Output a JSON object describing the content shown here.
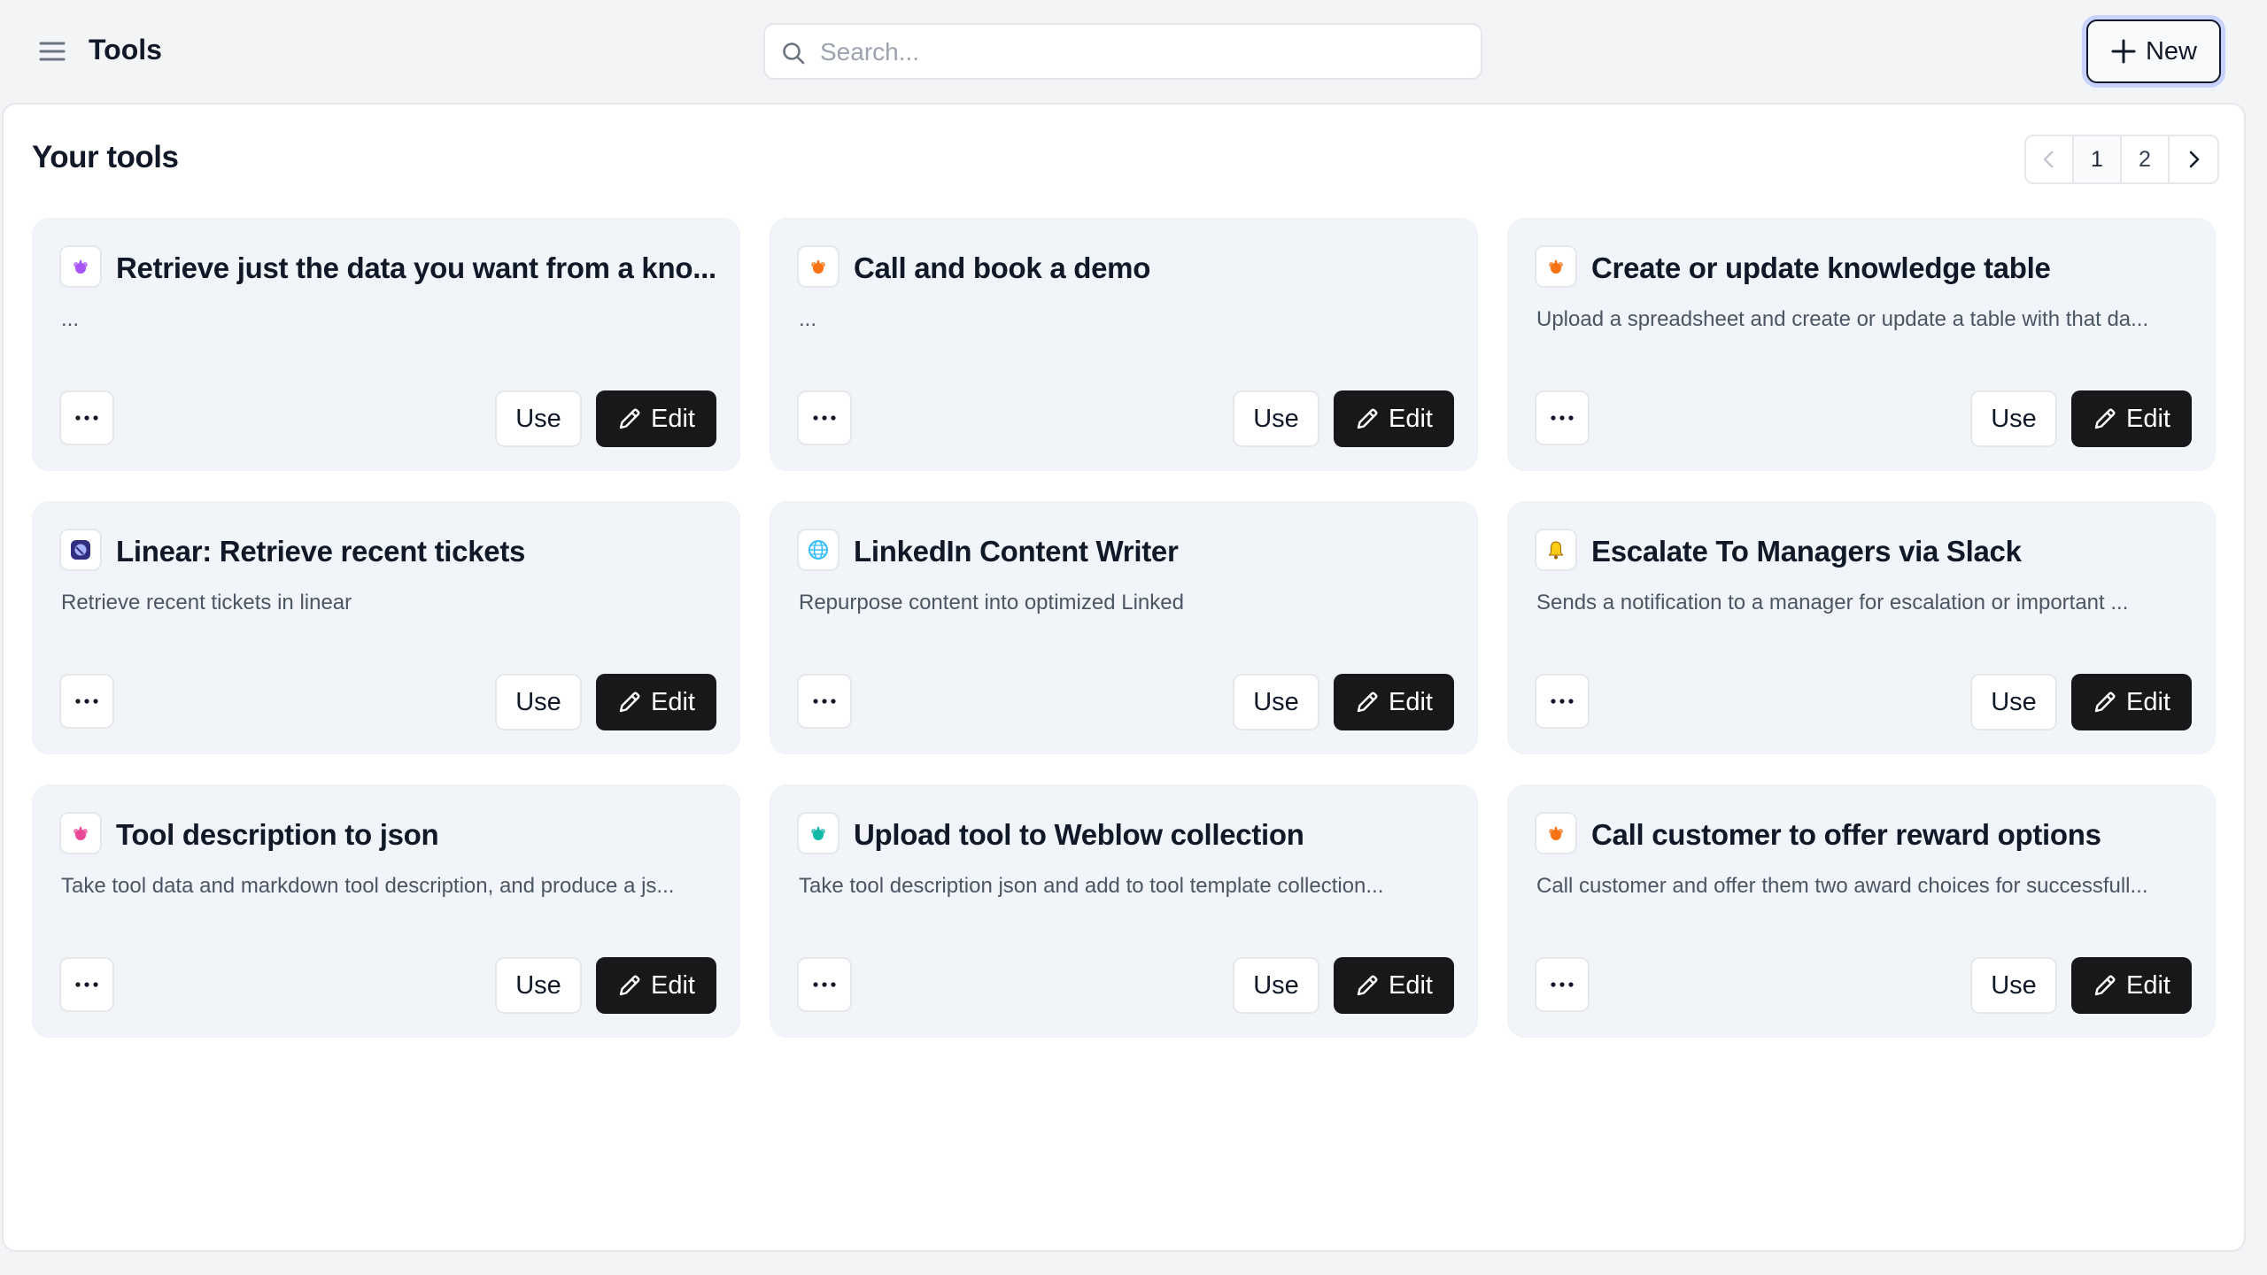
{
  "header": {
    "title": "Tools",
    "menu_icon": "hamburger-icon",
    "search": {
      "placeholder": "Search...",
      "value": ""
    },
    "new_label": "New"
  },
  "main": {
    "section_title": "Your tools",
    "pagination": {
      "pages": [
        "1",
        "2"
      ],
      "current": "1"
    }
  },
  "tools": [
    {
      "title": "Retrieve just the data you want from a kno...",
      "description": "...",
      "icon": "purple-flower-icon",
      "icon_color": "#a855f7"
    },
    {
      "title": "Call and book a demo",
      "description": "...",
      "icon": "orange-flower-icon",
      "icon_color": "#f97316"
    },
    {
      "title": "Create or update knowledge table",
      "description": "Upload a spreadsheet and create or update a table with that da...",
      "icon": "orange-flower-icon",
      "icon_color": "#f97316"
    },
    {
      "title": "Linear: Retrieve recent tickets",
      "description": "Retrieve recent tickets in linear",
      "icon": "linear-logo-icon",
      "icon_color": "#4f46e5"
    },
    {
      "title": "LinkedIn Content Writer",
      "description": "Repurpose content into optimized Linked",
      "icon": "globe-icon",
      "icon_color": "#38bdf8"
    },
    {
      "title": "Escalate To Managers via Slack",
      "description": "Sends a notification to a manager for escalation or important ...",
      "icon": "bell-icon",
      "icon_color": "#facc15"
    },
    {
      "title": "Tool description to json",
      "description": "Take tool data and markdown tool description, and produce a js...",
      "icon": "pink-flower-icon",
      "icon_color": "#ec4899"
    },
    {
      "title": "Upload tool to Weblow collection",
      "description": "Take tool description json and add to tool template collection...",
      "icon": "teal-flower-icon",
      "icon_color": "#14b8a6"
    },
    {
      "title": "Call customer to offer reward options",
      "description": "Call customer and offer them two award choices for successfull...",
      "icon": "orange-flower-icon",
      "icon_color": "#f97316"
    }
  ],
  "card_actions": {
    "more_label": "···",
    "use_label": "Use",
    "edit_label": "Edit"
  }
}
